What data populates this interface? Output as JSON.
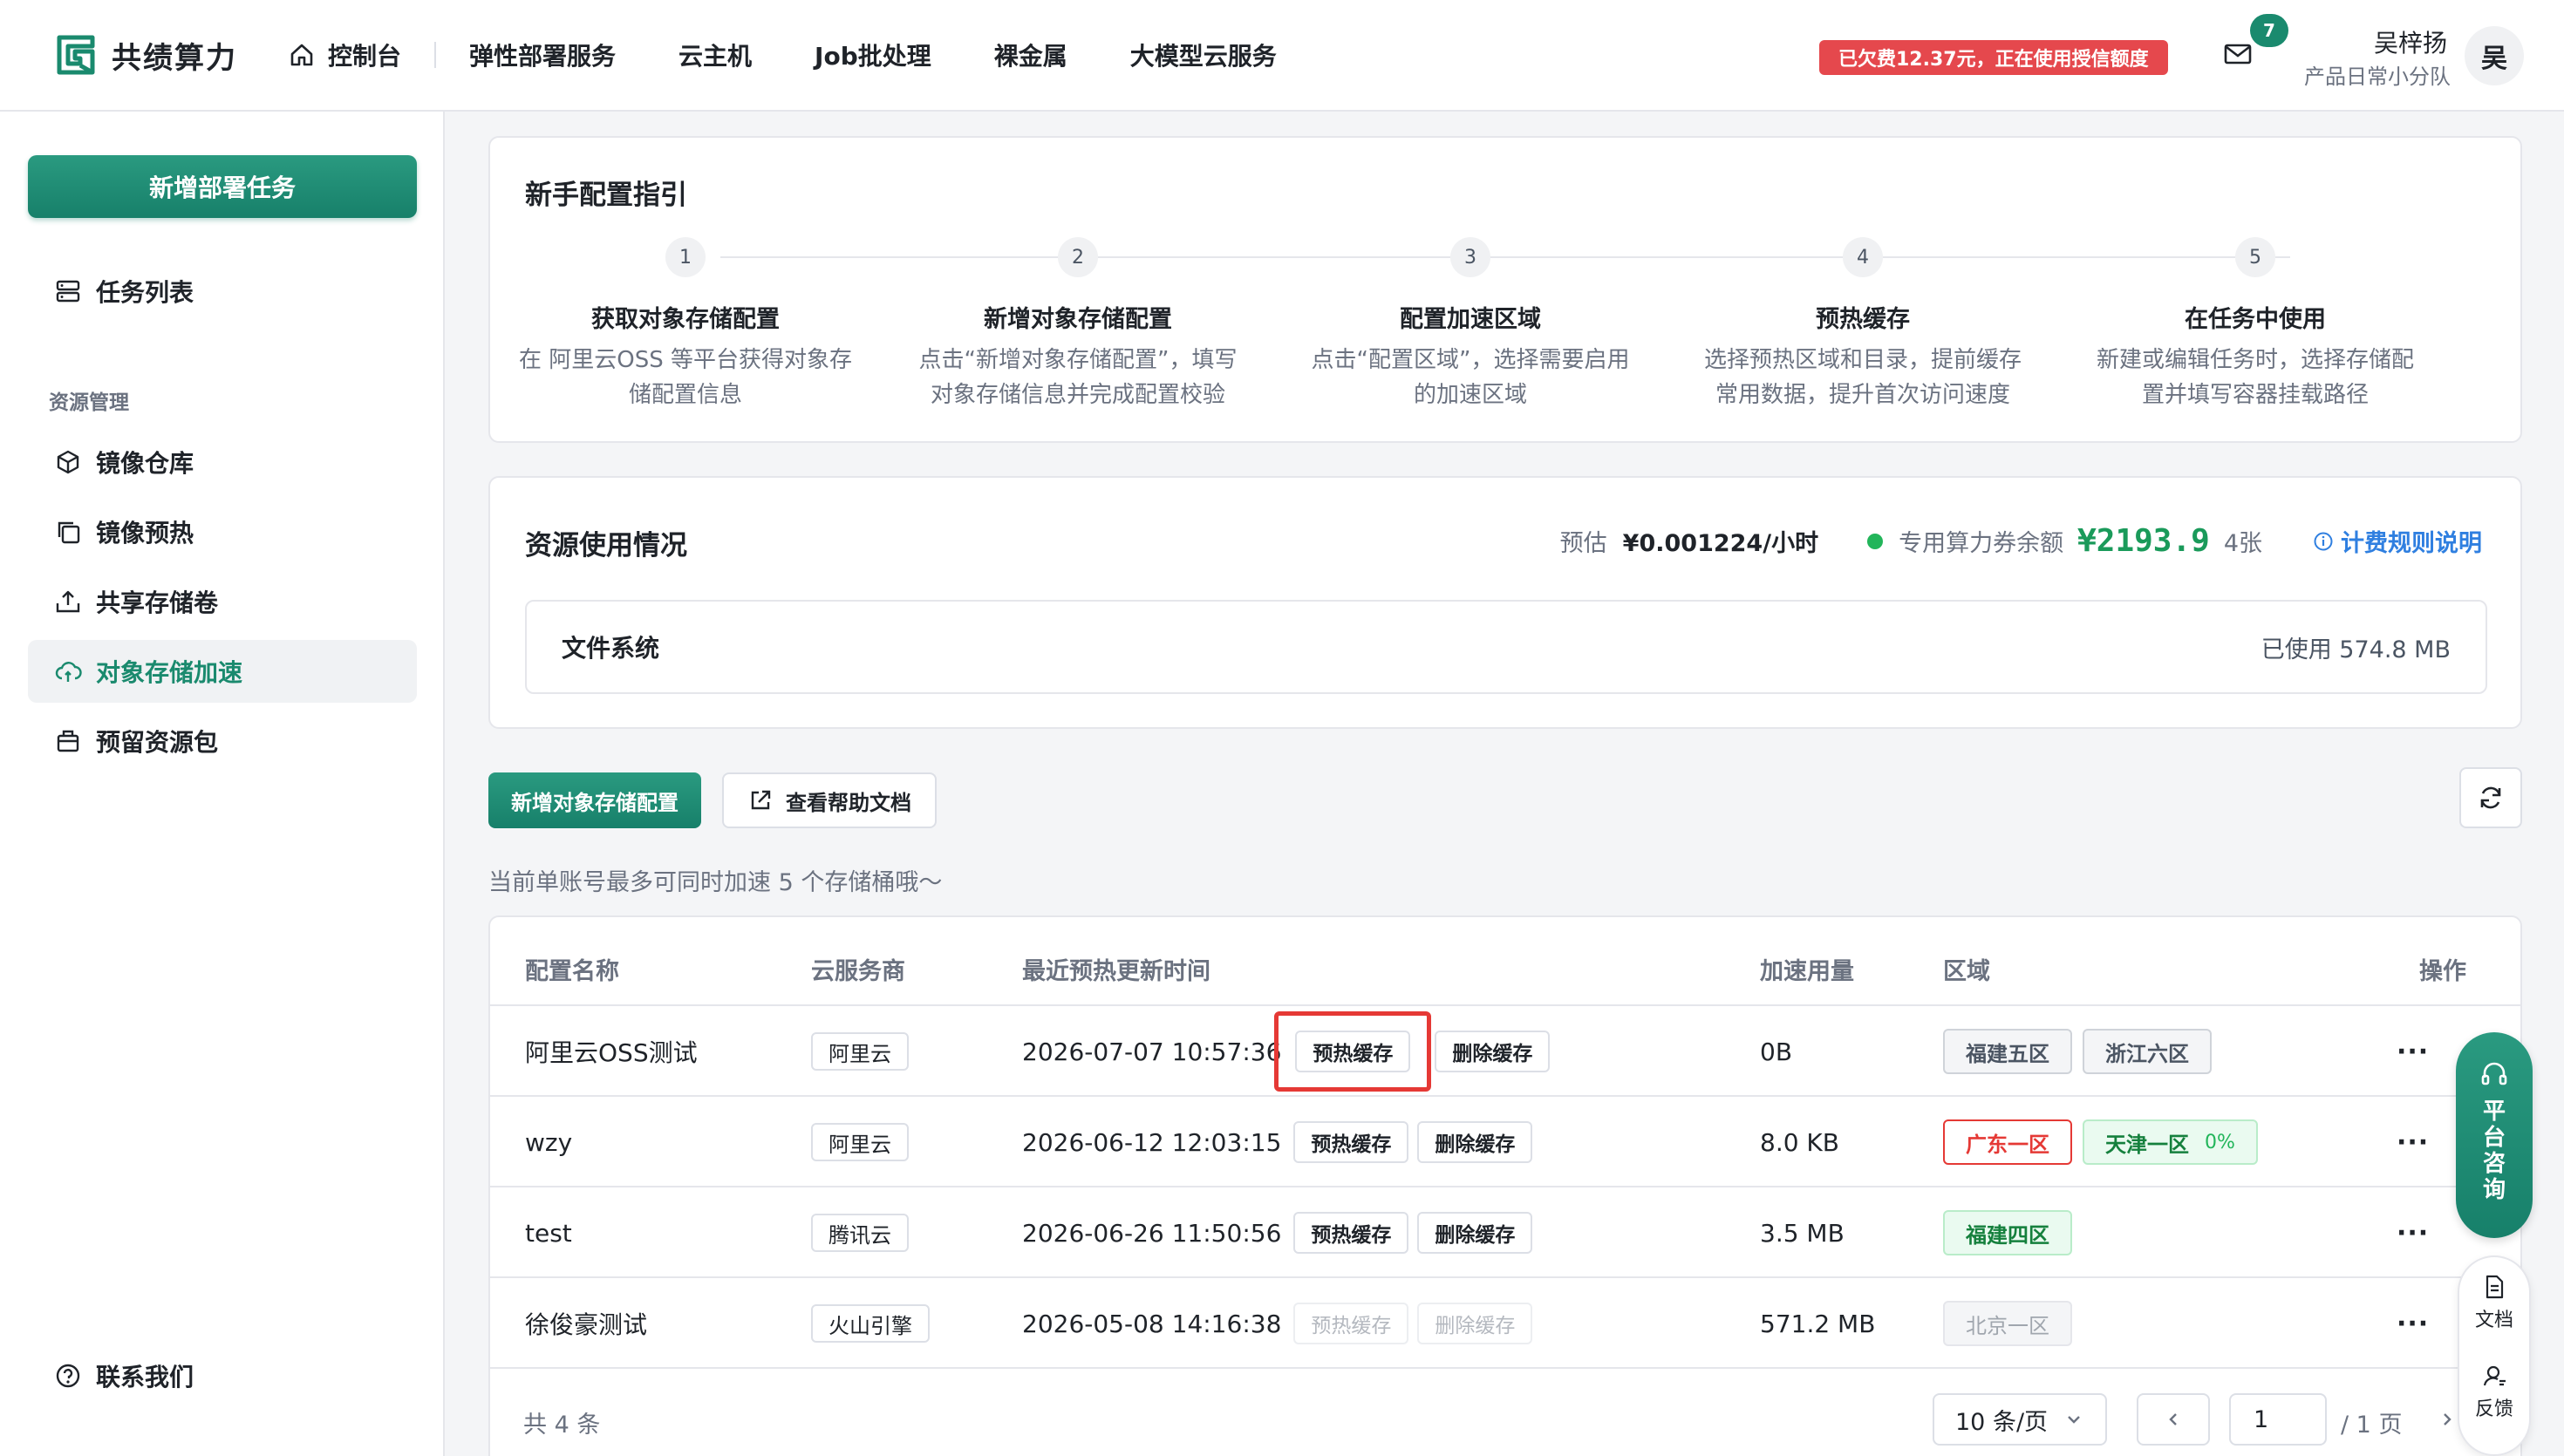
{
  "brand": {
    "name": "共绩算力",
    "color": "#1a8a6e"
  },
  "nav": {
    "home": "控制台",
    "items": [
      "弹性部署服务",
      "云主机",
      "Job批处理",
      "裸金属",
      "大模型云服务"
    ]
  },
  "header": {
    "debt_badge": "已欠费12.37元，正在使用授信额度",
    "mail_count": "7",
    "user_name": "吴梓扬",
    "user_team": "产品日常小分队",
    "avatar": "吴"
  },
  "sidebar": {
    "new_task": "新增部署任务",
    "task_list": "任务列表",
    "group_label": "资源管理",
    "items": [
      "镜像仓库",
      "镜像预热",
      "共享存储卷",
      "对象存储加速",
      "预留资源包"
    ],
    "active": "对象存储加速",
    "contact": "联系我们"
  },
  "guide": {
    "title": "新手配置指引",
    "steps": [
      {
        "num": "1",
        "title": "获取对象存储配置",
        "desc1": "在 阿里云OSS 等平台获得对象存",
        "desc2": "储配置信息"
      },
      {
        "num": "2",
        "title": "新增对象存储配置",
        "desc1": "点击“新增对象存储配置”，填写",
        "desc2": "对象存储信息并完成配置校验"
      },
      {
        "num": "3",
        "title": "配置加速区域",
        "desc1": "点击“配置区域”，选择需要启用",
        "desc2": "的加速区域"
      },
      {
        "num": "4",
        "title": "预热缓存",
        "desc1": "选择预热区域和目录，提前缓存",
        "desc2": "常用数据，提升首次访问速度"
      },
      {
        "num": "5",
        "title": "在任务中使用",
        "desc1": "新建或编辑任务时，选择存储配",
        "desc2": "置并填写容器挂载路径"
      }
    ]
  },
  "usage": {
    "title": "资源使用情况",
    "estimate_label": "预估",
    "estimate_value": "¥0.001224/小时",
    "voucher_label": "专用算力券余额",
    "voucher_value": "¥2193.9",
    "voucher_count": "4张",
    "billing_link": "计费规则说明",
    "fs_label": "文件系统",
    "fs_used": "已使用 574.8 MB"
  },
  "actions": {
    "add_config": "新增对象存储配置",
    "help_docs": "查看帮助文档",
    "hint": "当前单账号最多可同时加速 5 个存储桶哦～"
  },
  "table": {
    "headers": [
      "配置名称",
      "云服务商",
      "最近预热更新时间",
      "加速用量",
      "区域",
      "操作"
    ],
    "preheat_label": "预热缓存",
    "delete_label": "删除缓存",
    "more": "···",
    "rows": [
      {
        "name": "阿里云OSS测试",
        "vendor": "阿里云",
        "time": "2026-07-07 10:57:36",
        "usage": "0B",
        "regions": [
          {
            "label": "福建五区",
            "style": "gray"
          },
          {
            "label": "浙江六区",
            "style": "gray"
          }
        ],
        "disabled": false
      },
      {
        "name": "wzy",
        "vendor": "阿里云",
        "time": "2026-06-12 12:03:15",
        "usage": "8.0 KB",
        "regions": [
          {
            "label": "广东一区",
            "style": "red"
          },
          {
            "label": "天津一区",
            "style": "green",
            "pct": "0%"
          }
        ],
        "disabled": false
      },
      {
        "name": "test",
        "vendor": "腾讯云",
        "time": "2026-06-26 11:50:56",
        "usage": "3.5 MB",
        "regions": [
          {
            "label": "福建四区",
            "style": "green"
          }
        ],
        "disabled": false
      },
      {
        "name": "徐俊豪测试",
        "vendor": "火山引擎",
        "time": "2026-05-08 14:16:38",
        "usage": "571.2 MB",
        "regions": [
          {
            "label": "北京一区",
            "style": "disabled"
          }
        ],
        "disabled": true
      }
    ],
    "total": "共 4 条",
    "page_size": "10 条/页",
    "page_current": "1",
    "page_total": "/ 1 页"
  },
  "float": {
    "consult": "平台咨询",
    "docs": "文档",
    "feedback": "反馈"
  }
}
